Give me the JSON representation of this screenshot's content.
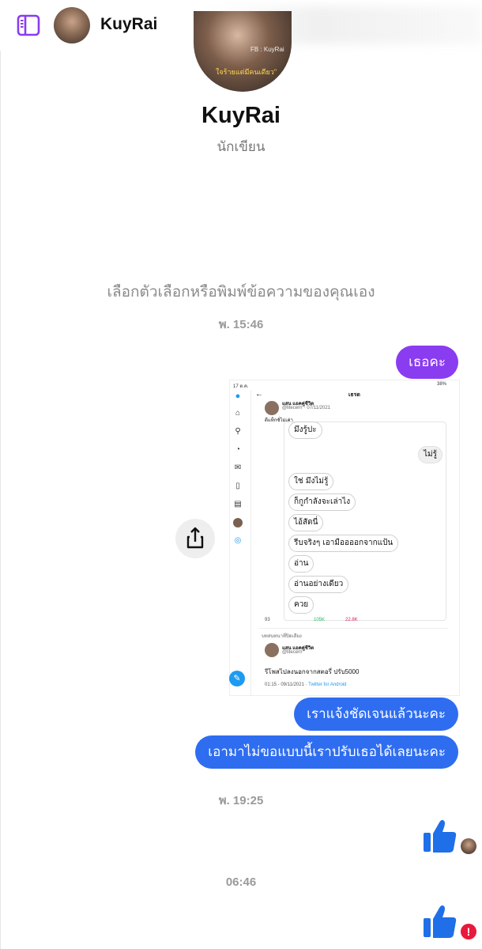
{
  "header": {
    "contact_name": "KuyRai",
    "sidebar_icon": "sidebar-toggle-icon"
  },
  "profile": {
    "name": "KuyRai",
    "subtitle": "นักเขียน",
    "avatar_fb_text": "FB : KuyRai",
    "avatar_caption": "ใจร้ายแต่มีคนเดียว\""
  },
  "prompt": "เลือกตัวเลือกหรือพิมพ์ข้อความของคุณเอง",
  "timestamps": [
    "พ. 15:46",
    "พ. 19:25",
    "06:46"
  ],
  "messages": [
    {
      "text": "เธอคะ",
      "color": "#8a3cf0"
    },
    {
      "text": "เราแจ้งชัดเจนแล้วนะคะ",
      "color": "#2f6df0"
    },
    {
      "text": "เอามาไม่ขอแบบนี้เราปรับเธอได้เลยนะคะ",
      "color": "#2f6df0"
    }
  ],
  "shared_screenshot": {
    "status_left": "17 ต.ค.",
    "status_right": "38%",
    "title": "เธรด",
    "tweet_author": "แสน แอคคู่ชีวิต",
    "tweet_handle": "@litecerrr · 07/11/2021",
    "tweet_note": "ดีแท็กซั่ไม่เค่า",
    "chat_lines": [
      "มึงรู้ปะ",
      "ไม่รู้",
      "ใช่ มึงไม่รู้",
      "ก็กูกำลังจะเล่าไง",
      "ไอ้สัดนี่",
      "รีบจริงๆ เอามืออออกจากแป้น",
      "อ่าน",
      "อ่านอย่างเดียว",
      "ควย"
    ],
    "stats": [
      "93",
      "105K",
      "22.8K"
    ],
    "reply_label": "บทสนทนาที่ปิดเสียง",
    "reply_author": "แสน แอคคู่ชีวิต",
    "reply_handle": "@litecerrr",
    "reply_text": "รีโพสไปลงนอกจากสตอรี่ ปรับ5000",
    "reply_meta": "01:15 - 09/11/2021 · ",
    "reply_source": "Twitter for Android"
  },
  "colors": {
    "accent_purple": "#8a3cf0",
    "bubble_blue": "#2f6df0",
    "like_blue": "#1f6fe8",
    "error_red": "#e8193c"
  }
}
